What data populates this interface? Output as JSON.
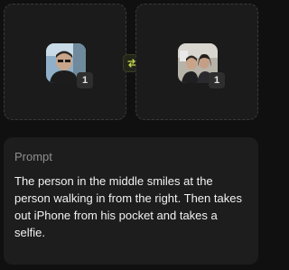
{
  "images": {
    "left": {
      "count": "1",
      "icon": "person-photo-thumbnail"
    },
    "right": {
      "count": "1",
      "icon": "selfie-photo-thumbnail"
    },
    "swap_icon": "swap-arrows-icon",
    "accent": "#c8d94a"
  },
  "prompt": {
    "title": "Prompt",
    "text": "The person in the middle smiles at the person walking in from the right. Then takes out iPhone from his pocket and takes a selfie."
  }
}
